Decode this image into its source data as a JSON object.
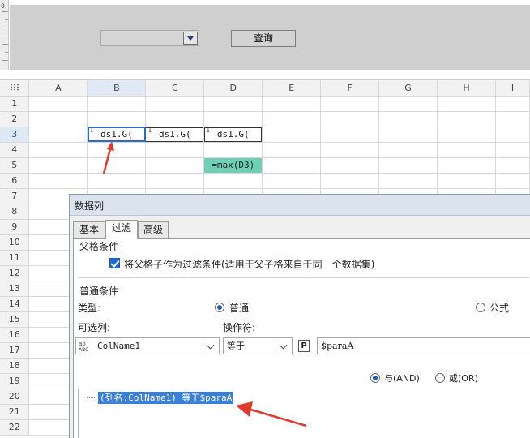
{
  "ruler": {
    "label": "0"
  },
  "parameter_panel": {
    "query_button_label": "查询",
    "combo_value": ""
  },
  "sheet": {
    "columns": [
      "A",
      "B",
      "C",
      "D",
      "E",
      "F",
      "G",
      "H",
      "I"
    ],
    "rows": [
      "1",
      "2",
      "3",
      "4",
      "5",
      "6",
      "7",
      "8",
      "9",
      "10",
      "11",
      "12",
      "13",
      "14",
      "15",
      "16",
      "17",
      "18",
      "19",
      "20",
      "21",
      "22"
    ],
    "cells": {
      "B3": "ds1.G(",
      "C3": "ds1.G(",
      "D3": "ds1.G(",
      "D5": "=max(D3)"
    },
    "expand_arrow": "↓",
    "formula_cell_color": "#6fcfb4",
    "selection_color": "#2b6bc4"
  },
  "annotation_color": "#e03a2f",
  "dialog": {
    "title": "数据列",
    "tabs": [
      {
        "label": "基本",
        "active": false
      },
      {
        "label": "过滤",
        "active": true
      },
      {
        "label": "高级",
        "active": false
      }
    ],
    "parent_section": {
      "label": "父格条件",
      "checkbox_label": "将父格子作为过滤条件(适用于父子格来自于同一个数据集)",
      "checked": true
    },
    "normal_section": {
      "label": "普通条件",
      "type_label": "类型:",
      "type_options": [
        {
          "label": "普通",
          "selected": true
        },
        {
          "label": "公式",
          "selected": false
        }
      ],
      "column_label": "可选列:",
      "column_value": "ColName1",
      "operator_label": "操作符:",
      "operator_value": "等于",
      "param_icon": "P",
      "value": "$paraA",
      "logic_options": [
        {
          "label": "与(AND)",
          "selected": true
        },
        {
          "label": "或(OR)",
          "selected": false
        }
      ],
      "conditions": [
        "(列名:ColName1) 等于$paraA"
      ]
    }
  }
}
